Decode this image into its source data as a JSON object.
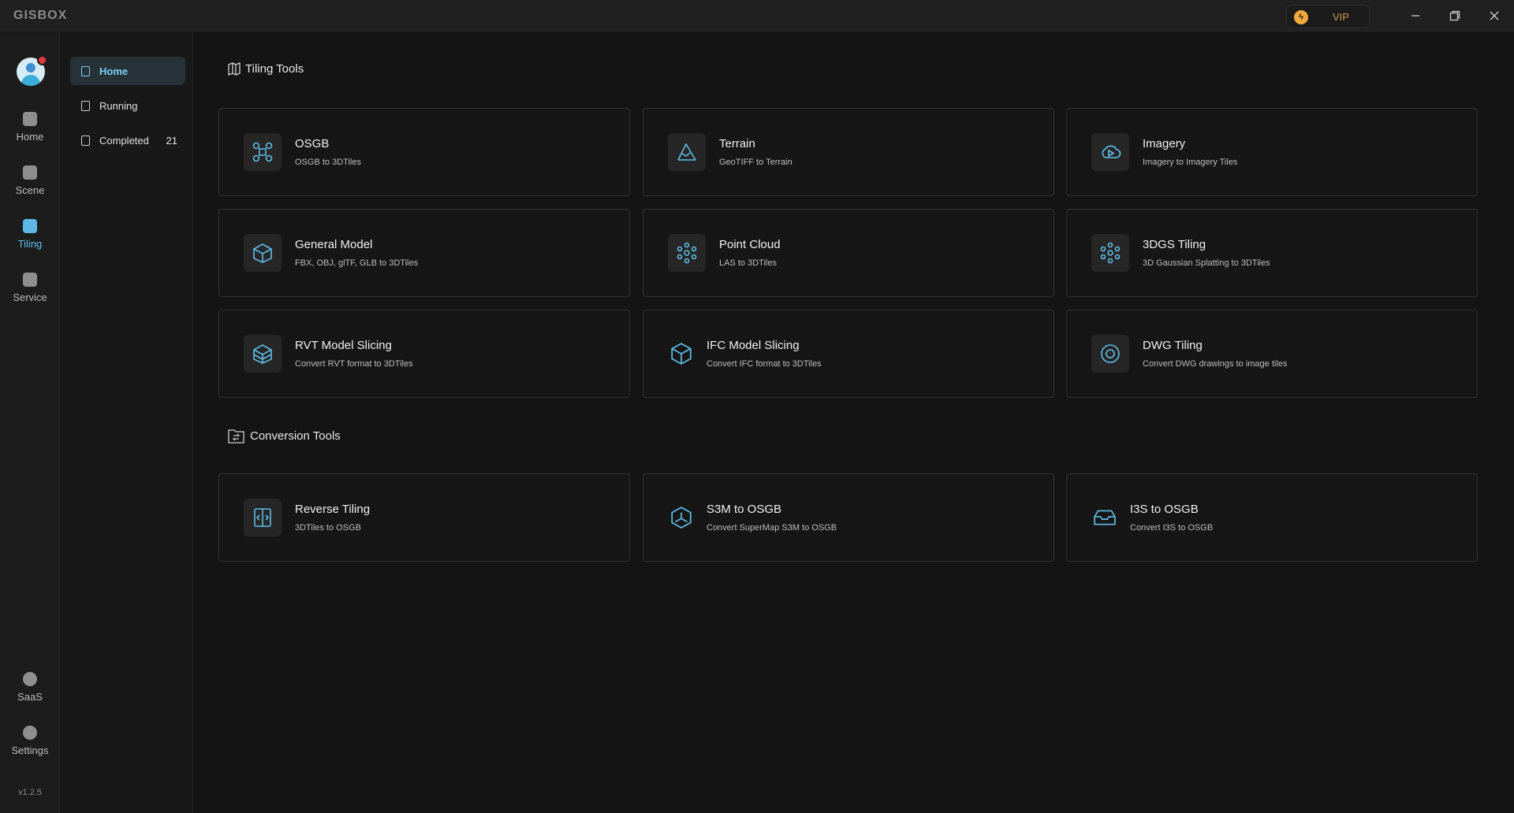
{
  "app": {
    "logo": "GISBOX",
    "vip_label": "VIP",
    "version": "v1.2.5"
  },
  "rail": {
    "items": [
      {
        "label": "Home",
        "icon": "home-icon",
        "active": false
      },
      {
        "label": "Scene",
        "icon": "scene-icon",
        "active": false
      },
      {
        "label": "Tiling",
        "icon": "tiling-icon",
        "active": true
      },
      {
        "label": "Service",
        "icon": "service-icon",
        "active": false
      }
    ],
    "bottom": [
      {
        "label": "SaaS",
        "icon": "saas-icon"
      },
      {
        "label": "Settings",
        "icon": "settings-icon"
      }
    ]
  },
  "subnav": {
    "items": [
      {
        "label": "Home",
        "active": true
      },
      {
        "label": "Running",
        "active": false
      },
      {
        "label": "Completed",
        "count": "21",
        "active": false
      }
    ]
  },
  "sections": {
    "tiling": {
      "title": "Tiling Tools",
      "cards": [
        {
          "title": "OSGB",
          "subtitle": "OSGB to 3DTiles",
          "icon": "osgb-icon"
        },
        {
          "title": "Terrain",
          "subtitle": "GeoTIFF to Terrain",
          "icon": "terrain-icon"
        },
        {
          "title": "Imagery",
          "subtitle": "Imagery to Imagery Tiles",
          "icon": "imagery-icon"
        },
        {
          "title": "General Model",
          "subtitle": "FBX, OBJ, glTF, GLB to 3DTiles",
          "icon": "general-model-icon"
        },
        {
          "title": "Point Cloud",
          "subtitle": "LAS to 3DTiles",
          "icon": "point-cloud-icon"
        },
        {
          "title": "3DGS Tiling",
          "subtitle": "3D Gaussian Splatting to 3DTiles",
          "icon": "gaussian-splatting-icon"
        },
        {
          "title": "RVT Model Slicing",
          "subtitle": "Convert RVT format to 3DTiles",
          "icon": "rvt-icon"
        },
        {
          "title": "IFC Model Slicing",
          "subtitle": "Convert IFC format to 3DTiles",
          "icon": "ifc-icon"
        },
        {
          "title": "DWG Tiling",
          "subtitle": "Convert DWG drawings to image tiles",
          "icon": "dwg-icon"
        }
      ]
    },
    "conversion": {
      "title": "Conversion Tools",
      "cards": [
        {
          "title": "Reverse Tiling",
          "subtitle": "3DTiles to OSGB",
          "icon": "reverse-tiling-icon"
        },
        {
          "title": "S3M to OSGB",
          "subtitle": "Convert SuperMap S3M to OSGB",
          "icon": "s3m-icon"
        },
        {
          "title": "I3S to OSGB",
          "subtitle": "Convert I3S to OSGB",
          "icon": "i3s-icon"
        }
      ]
    }
  },
  "colors": {
    "accent": "#5fbde8",
    "background": "#141414",
    "card_border": "#343434",
    "vip": "#f0a93b"
  }
}
